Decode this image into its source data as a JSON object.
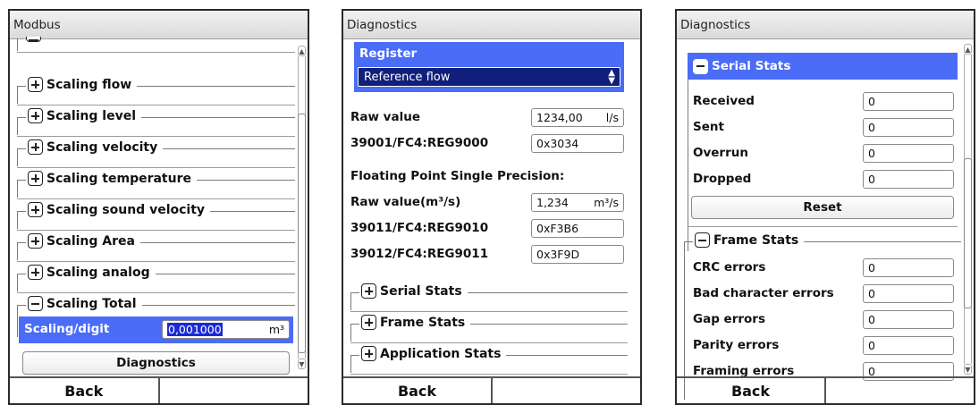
{
  "panel1": {
    "title": "Modbus",
    "groups": [
      "Scaling flow",
      "Scaling level",
      "Scaling velocity",
      "Scaling temperature",
      "Scaling sound velocity",
      "Scaling Area",
      "Scaling analog"
    ],
    "open_group": "Scaling Total",
    "scaling_label": "Scaling/digit",
    "scaling_value": "0,001000",
    "scaling_unit": "m³",
    "diagnostics_button": "Diagnostics",
    "back": "Back"
  },
  "panel2": {
    "title": "Diagnostics",
    "register_label": "Register",
    "register_value": "Reference flow",
    "raw_value_label": "Raw value",
    "raw_value": "1234,00",
    "raw_value_unit": "l/s",
    "reg9000_label": "39001/FC4:REG9000",
    "reg9000_value": "0x3034",
    "fp_heading": "Floating Point Single Precision:",
    "raw_value_m3_label": "Raw value(m³/s)",
    "raw_value_m3": "1,234",
    "raw_value_m3_unit": "m³/s",
    "reg9010_label": "39011/FC4:REG9010",
    "reg9010_value": "0xF3B6",
    "reg9011_label": "39012/FC4:REG9011",
    "reg9011_value": "0x3F9D",
    "groups": [
      "Serial Stats",
      "Frame Stats",
      "Application Stats"
    ],
    "back": "Back"
  },
  "panel3": {
    "title": "Diagnostics",
    "serial_stats_title": "Serial Stats",
    "serial_rows": [
      {
        "label": "Received",
        "value": "0"
      },
      {
        "label": "Sent",
        "value": "0"
      },
      {
        "label": "Overrun",
        "value": "0"
      },
      {
        "label": "Dropped",
        "value": "0"
      }
    ],
    "reset_button": "Reset",
    "frame_stats_title": "Frame Stats",
    "frame_rows": [
      {
        "label": "CRC errors",
        "value": "0"
      },
      {
        "label": "Bad character errors",
        "value": "0"
      },
      {
        "label": "Gap errors",
        "value": "0"
      },
      {
        "label": "Parity errors",
        "value": "0"
      },
      {
        "label": "Framing errors",
        "value": "0"
      }
    ],
    "back": "Back"
  },
  "colors": {
    "highlight": "#4a6cf7",
    "select_bg": "#0f1f7a",
    "selection_text_bg": "#1b2bd6"
  },
  "icons": [
    "plus-icon",
    "minus-icon",
    "updown-arrows-icon",
    "scroll-up-icon",
    "scroll-down-icon"
  ]
}
